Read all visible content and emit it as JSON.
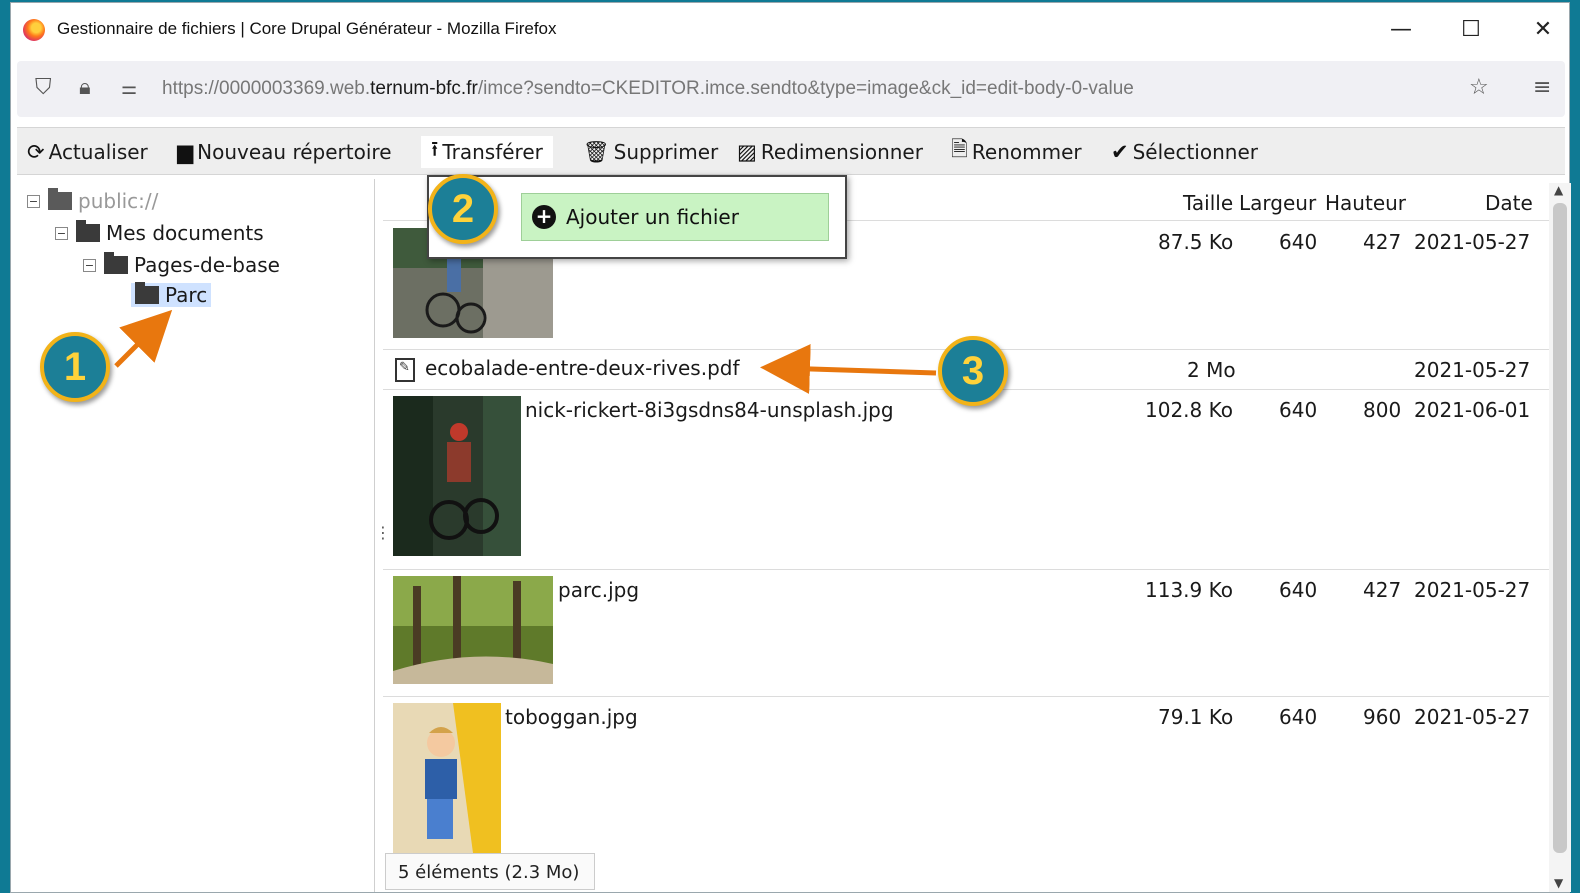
{
  "window": {
    "title": "Gestionnaire de fichiers | Core Drupal Générateur - Mozilla Firefox",
    "url_prefix": "https://0000003369.web.",
    "url_domain": "ternum-bfc.fr",
    "url_suffix": "/imce?sendto=CKEDITOR.imce.sendto&type=image&ck_id=edit-body-0-value"
  },
  "toolbar": {
    "refresh": "Actualiser",
    "new_folder": "Nouveau répertoire",
    "upload": "Transférer",
    "delete": "Supprimer",
    "resize": "Redimensionner",
    "rename": "Renommer",
    "select": "Sélectionner"
  },
  "tree": {
    "root": "public://",
    "level1": "Mes documents",
    "level2": "Pages-de-base",
    "level3": "Parc"
  },
  "columns": {
    "size": "Taille",
    "width": "Largeur",
    "height": "Hauteur",
    "date": "Date"
  },
  "files": [
    {
      "name": "",
      "size": "87.5 Ko",
      "width": "640",
      "height": "427",
      "date": "2021-05-27"
    },
    {
      "name": "ecobalade-entre-deux-rives.pdf",
      "size": "2 Mo",
      "width": "",
      "height": "",
      "date": "2021-05-27"
    },
    {
      "name": "nick-rickert-8i3gsdns84-unsplash.jpg",
      "size": "102.8 Ko",
      "width": "640",
      "height": "800",
      "date": "2021-06-01"
    },
    {
      "name": "parc.jpg",
      "size": "113.9 Ko",
      "width": "640",
      "height": "427",
      "date": "2021-05-27"
    },
    {
      "name": "toboggan.jpg",
      "size": "79.1 Ko",
      "width": "640",
      "height": "960",
      "date": "2021-05-27"
    }
  ],
  "status": "5 éléments (2.3 Mo)",
  "menu": {
    "add_file": "Ajouter un fichier"
  },
  "annotations": {
    "badge1": "1",
    "badge2": "2",
    "badge3": "3",
    "color_badge_fill": "#1c7f97",
    "color_badge_ring": "#f2b319",
    "color_arrow": "#e8770e"
  }
}
